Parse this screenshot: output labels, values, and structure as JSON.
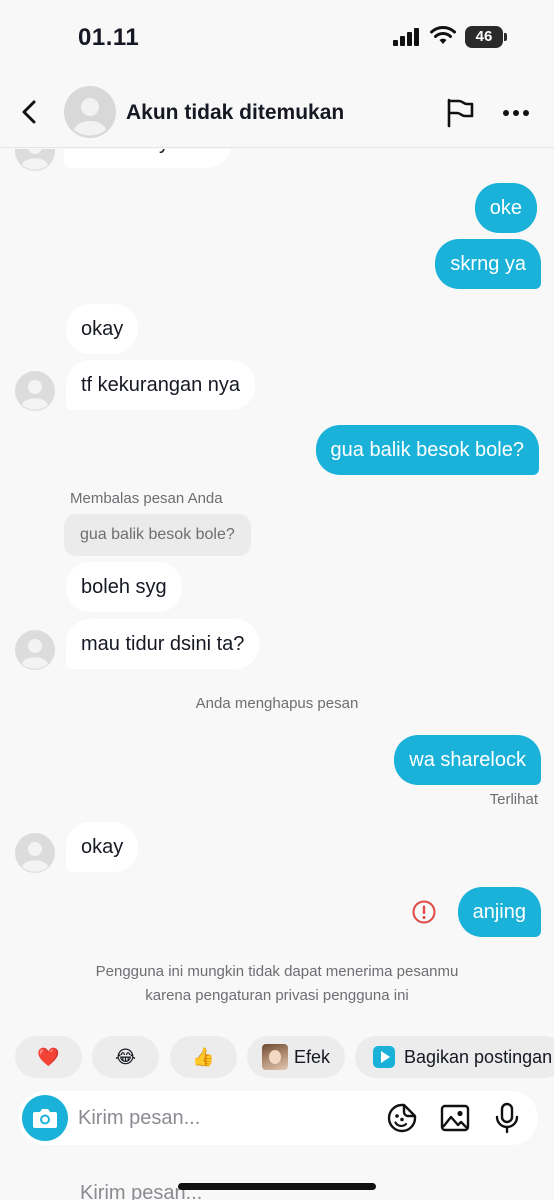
{
  "status_bar": {
    "time": "01.11",
    "battery": "46"
  },
  "header": {
    "title": "Akun tidak ditemukan",
    "icons": [
      "back-icon",
      "avatar",
      "flag-icon",
      "more-icon"
    ]
  },
  "chat": {
    "cut_message": "di kos bnyk kok",
    "msgs": {
      "m1": "oke",
      "m2": "skrng ya",
      "m3": "okay",
      "m4": "tf kekurangan nya",
      "m5": "gua balik besok bole?",
      "reply_label": "Membalas pesan Anda",
      "reply_quote": "gua balik besok bole?",
      "m6": "boleh syg",
      "m7": "mau tidur dsini ta?",
      "deleted_notice": "Anda menghapus pesan",
      "m8": "wa sharelock",
      "seen": "Terlihat",
      "m9": "okay",
      "m10": "anjing"
    },
    "privacy_notice_line1": "Pengguna ini mungkin tidak dapat menerima pesanmu",
    "privacy_notice_line2": "karena pengaturan privasi pengguna ini"
  },
  "quick_actions": {
    "heart": "❤️",
    "laugh": "😂",
    "thumbs": "👍",
    "effect": "Efek",
    "share": "Bagikan postingan"
  },
  "input": {
    "placeholder": "Kirim pesan...",
    "ghost_text": "Kirim pesan..."
  },
  "colors": {
    "accent": "#1ab2d9",
    "error": "#e04646",
    "background": "#f8f8f8"
  }
}
